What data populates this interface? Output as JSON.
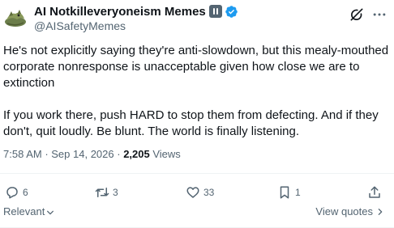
{
  "author": {
    "display_name": "AI Notkilleveryoneism Memes",
    "handle": "@AISafetyMemes",
    "badges": [
      "pause-badge",
      "verified-badge"
    ],
    "verified_color": "#1d9bf0"
  },
  "header_icons": [
    "grok-icon",
    "more-icon"
  ],
  "post": {
    "paragraph_1": "He's not explicitly saying they're anti-slowdown, but this mealy-mouthed corporate nonresponse is unacceptable given how close we are to extinction",
    "paragraph_2": "If you work there, push HARD to stop them from defecting. And if they don't, quit loudly. Be blunt. The world is finally listening."
  },
  "meta": {
    "time": "7:58 AM",
    "separator": " · ",
    "date": "Sep 14, 2026",
    "views_count": "2,205",
    "views_label": "Views"
  },
  "actions": {
    "replies": "6",
    "reposts": "3",
    "likes": "33",
    "bookmarks": "1"
  },
  "footer": {
    "sort_label": "Relevant",
    "view_quotes": "View quotes"
  },
  "colors": {
    "text": "#0f1419",
    "secondary": "#536471",
    "divider": "#eff3f4"
  }
}
